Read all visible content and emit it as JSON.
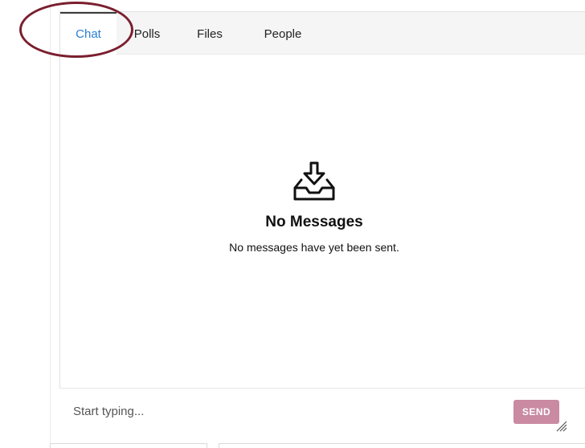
{
  "tabs": [
    {
      "label": "Chat",
      "active": true
    },
    {
      "label": "Polls",
      "active": false
    },
    {
      "label": "Files",
      "active": false
    },
    {
      "label": "People",
      "active": false
    }
  ],
  "empty_state": {
    "icon": "inbox-download-icon",
    "title": "No Messages",
    "subtitle": "No messages have yet been sent."
  },
  "composer": {
    "placeholder": "Start typing...",
    "send_label": "SEND"
  },
  "colors": {
    "active_tab_text": "#2a7fd4",
    "send_button": "#c98aa2",
    "annotation": "#7a1f2e",
    "tabbar_bg": "#f5f5f5"
  }
}
